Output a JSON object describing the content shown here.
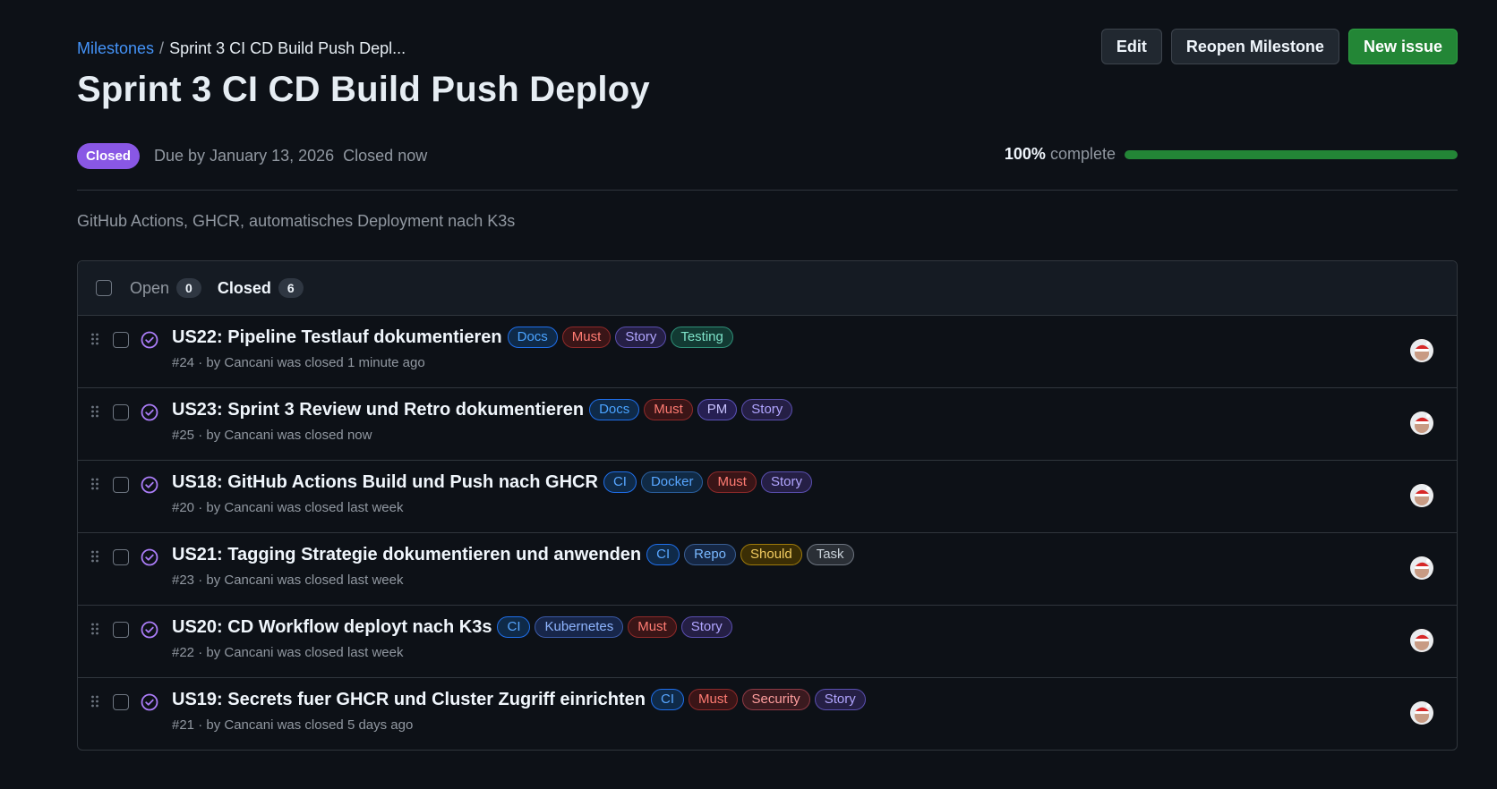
{
  "breadcrumb": {
    "root": "Milestones",
    "separator": "/",
    "current": "Sprint 3 CI CD Build Push Depl..."
  },
  "title": "Sprint 3 CI CD Build Push Deploy",
  "actions": {
    "edit": "Edit",
    "reopen": "Reopen Milestone",
    "new_issue": "New issue"
  },
  "meta": {
    "state": "Closed",
    "due": "Due by January 13, 2026",
    "closed": "Closed now",
    "percent_text": "100%",
    "complete_text": "complete",
    "progress_fraction": 1.0
  },
  "description": "GitHub Actions, GHCR, automatisches Deployment nach K3s",
  "filters": {
    "open_label": "Open",
    "open_count": "0",
    "closed_label": "Closed",
    "closed_count": "6"
  },
  "label_colors": {
    "Docs": {
      "fg": "#4aa3ff",
      "bg": "#0f2a48",
      "border": "#1f6feb"
    },
    "Must": {
      "fg": "#ff7b72",
      "bg": "#3a1517",
      "border": "#8e2a2a"
    },
    "Story": {
      "fg": "#b1a5ff",
      "bg": "#251f45",
      "border": "#5a4fb0"
    },
    "Testing": {
      "fg": "#7ee2c9",
      "bg": "#123a33",
      "border": "#2f8f78"
    },
    "PM": {
      "fg": "#c9c3ff",
      "bg": "#261f52",
      "border": "#5b52b8"
    },
    "CI": {
      "fg": "#58a6ff",
      "bg": "#0f2a48",
      "border": "#1f6feb"
    },
    "Docker": {
      "fg": "#58a6ff",
      "bg": "#102a45",
      "border": "#2a5f9e"
    },
    "Repo": {
      "fg": "#79b8ff",
      "bg": "#152744",
      "border": "#3a5f94"
    },
    "Should": {
      "fg": "#f2cc60",
      "bg": "#3b2e05",
      "border": "#9e7a0a"
    },
    "Task": {
      "fg": "#c9d1d9",
      "bg": "#2a2f36",
      "border": "#6e7681"
    },
    "Kubernetes": {
      "fg": "#8fb5ff",
      "bg": "#17264a",
      "border": "#3b5aa8"
    },
    "Security": {
      "fg": "#ff9e9e",
      "bg": "#3a1a1f",
      "border": "#8e3a45"
    }
  },
  "issues": [
    {
      "title": "US22: Pipeline Testlauf dokumentieren",
      "labels": [
        "Docs",
        "Must",
        "Story",
        "Testing"
      ],
      "meta": "#24 · by Cancani was closed 1 minute ago"
    },
    {
      "title": "US23: Sprint 3 Review und Retro dokumentieren",
      "labels": [
        "Docs",
        "Must",
        "PM",
        "Story"
      ],
      "meta": "#25 · by Cancani was closed now"
    },
    {
      "title": "US18: GitHub Actions Build und Push nach GHCR",
      "labels": [
        "CI",
        "Docker",
        "Must",
        "Story"
      ],
      "meta": "#20 · by Cancani was closed last week"
    },
    {
      "title": "US21: Tagging Strategie dokumentieren und anwenden",
      "labels": [
        "CI",
        "Repo",
        "Should",
        "Task"
      ],
      "meta": "#23 · by Cancani was closed last week"
    },
    {
      "title": "US20: CD Workflow deployt nach K3s",
      "labels": [
        "CI",
        "Kubernetes",
        "Must",
        "Story"
      ],
      "meta": "#22 · by Cancani was closed last week"
    },
    {
      "title": "US19: Secrets fuer GHCR und Cluster Zugriff einrichten",
      "labels": [
        "CI",
        "Must",
        "Security",
        "Story"
      ],
      "meta": "#21 · by Cancani was closed 5 days ago"
    }
  ]
}
